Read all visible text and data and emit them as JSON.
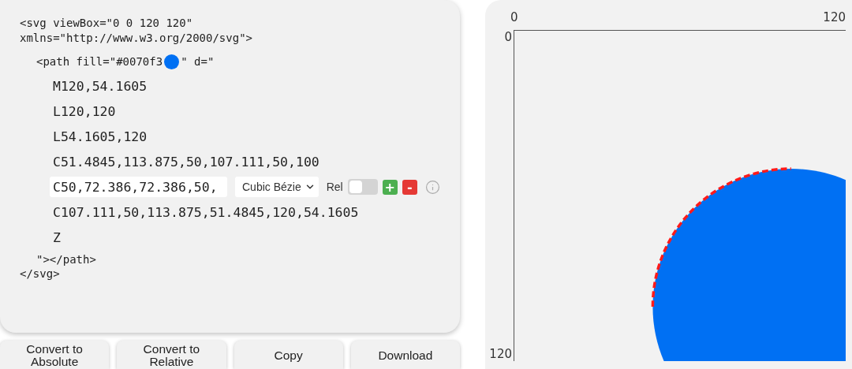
{
  "code": {
    "svg_open": "<svg viewBox=\"0 0 120 120\"",
    "svg_xmlns": "xmlns=\"http://www.w3.org/2000/svg\">",
    "path_prefix": "<path fill=\"",
    "fill": "#0070f3",
    "path_suffix": "\" d=\"",
    "commands": [
      {
        "kind": "text",
        "text": "M120,54.1605"
      },
      {
        "kind": "text",
        "text": "L120,120"
      },
      {
        "kind": "text",
        "text": "L54.1605,120"
      },
      {
        "kind": "text",
        "text": "C51.4845,113.875,50,107.111,50,100"
      },
      {
        "kind": "edit",
        "value": "C50,72.386,72.386,50,",
        "segment_type": "Cubic Bézie",
        "rel_label": "Rel",
        "rel_on": false,
        "add": "+",
        "remove": "-"
      },
      {
        "kind": "text",
        "text": "C107.111,50,113.875,51.4845,120,54.1605"
      },
      {
        "kind": "text",
        "text": "Z"
      }
    ],
    "path_close": "\"></path>",
    "svg_close": "</svg>"
  },
  "canvas": {
    "x_labels": [
      "0",
      "120"
    ],
    "y_labels": [
      "0",
      "120"
    ]
  },
  "buttons": [
    "Convert to Absolute",
    "Convert to Relative",
    "Copy",
    "Download"
  ]
}
